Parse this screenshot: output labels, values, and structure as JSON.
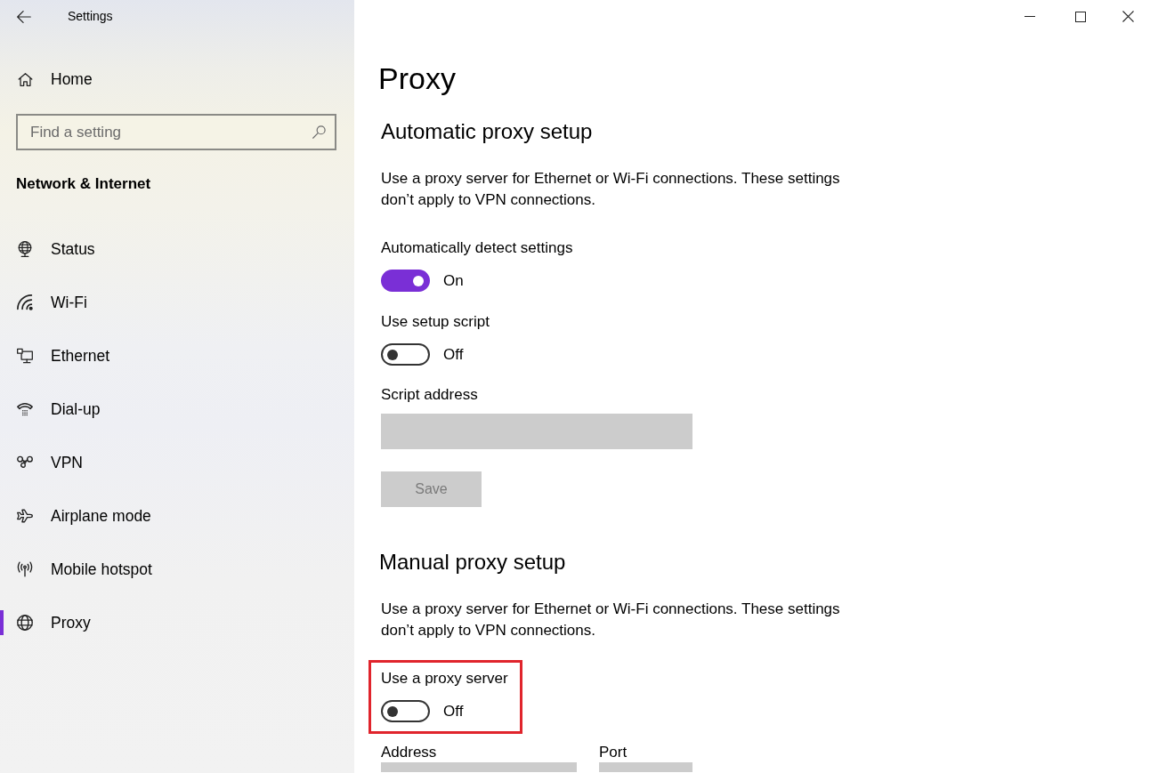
{
  "window": {
    "title": "Settings"
  },
  "sidebar": {
    "home": "Home",
    "search": {
      "placeholder": "Find a setting"
    },
    "section": "Network & Internet",
    "items": [
      {
        "kind": "status",
        "label": "Status",
        "selected": false
      },
      {
        "kind": "wifi",
        "label": "Wi-Fi",
        "selected": false
      },
      {
        "kind": "ethernet",
        "label": "Ethernet",
        "selected": false
      },
      {
        "kind": "dialup",
        "label": "Dial-up",
        "selected": false
      },
      {
        "kind": "vpn",
        "label": "VPN",
        "selected": false
      },
      {
        "kind": "airplane",
        "label": "Airplane mode",
        "selected": false
      },
      {
        "kind": "hotspot",
        "label": "Mobile hotspot",
        "selected": false
      },
      {
        "kind": "proxy",
        "label": "Proxy",
        "selected": true
      }
    ]
  },
  "page": {
    "title": "Proxy",
    "sections": [
      {
        "heading": "Automatic proxy setup",
        "description": "Use a proxy server for Ethernet or Wi-Fi connections. These settings don’t apply to VPN connections.",
        "settings": [
          {
            "kind": "toggle",
            "label": "Automatically detect settings",
            "on": true,
            "state_text": "On"
          },
          {
            "kind": "toggle",
            "label": "Use setup script",
            "on": false,
            "state_text": "Off"
          },
          {
            "kind": "field",
            "label": "Script address",
            "disabled": true
          },
          {
            "kind": "button",
            "label": "Save",
            "disabled": true
          }
        ]
      },
      {
        "heading": "Manual proxy setup",
        "description": "Use a proxy server for Ethernet or Wi-Fi connections. These settings don’t apply to VPN connections.",
        "settings": [
          {
            "kind": "toggle",
            "label": "Use a proxy server",
            "on": false,
            "state_text": "Off",
            "highlighted": true
          },
          {
            "kind": "fieldpair",
            "fields": [
              {
                "label": "Address",
                "disabled": true
              },
              {
                "label": "Port",
                "disabled": true
              }
            ]
          }
        ]
      }
    ]
  }
}
